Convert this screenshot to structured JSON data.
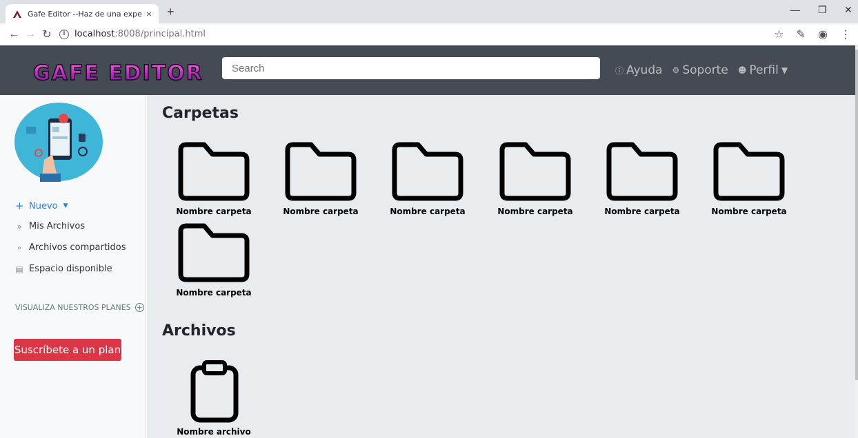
{
  "browser": {
    "tab_title": "Gafe Editor --Haz de una experie",
    "new_tab": "+",
    "close_tab": "×",
    "url_host": "localhost",
    "url_path": ":8008/principal.html"
  },
  "header": {
    "logo_text": "GAFE EDITOR",
    "search_placeholder": "Search",
    "nav": {
      "help": "Ayuda",
      "support": "Soporte",
      "profile": "Perfil"
    }
  },
  "sidebar": {
    "new_label": "Nuevo",
    "items": [
      {
        "label": "Mis Archivos",
        "icon": "double-chevron-icon"
      },
      {
        "label": "Archivos compartidos",
        "icon": "share-icon"
      },
      {
        "label": "Espacio disponible",
        "icon": "database-icon"
      }
    ],
    "plans_label": "VISUALIZA NUESTROS PLANES",
    "subscribe_label": "Suscríbete a un plan"
  },
  "main": {
    "folders_title": "Carpetas",
    "folders": [
      "Nombre carpeta",
      "Nombre carpeta",
      "Nombre carpeta",
      "Nombre carpeta",
      "Nombre carpeta",
      "Nombre carpeta",
      "Nombre carpeta"
    ],
    "files_title": "Archivos",
    "files": [
      "Nombre archivo"
    ]
  },
  "colors": {
    "header_bg": "#444b53",
    "accent": "#2e7ee3",
    "danger": "#dc3545",
    "main_bg": "#e9ecef",
    "sidebar_bg": "#f8f9fa"
  }
}
